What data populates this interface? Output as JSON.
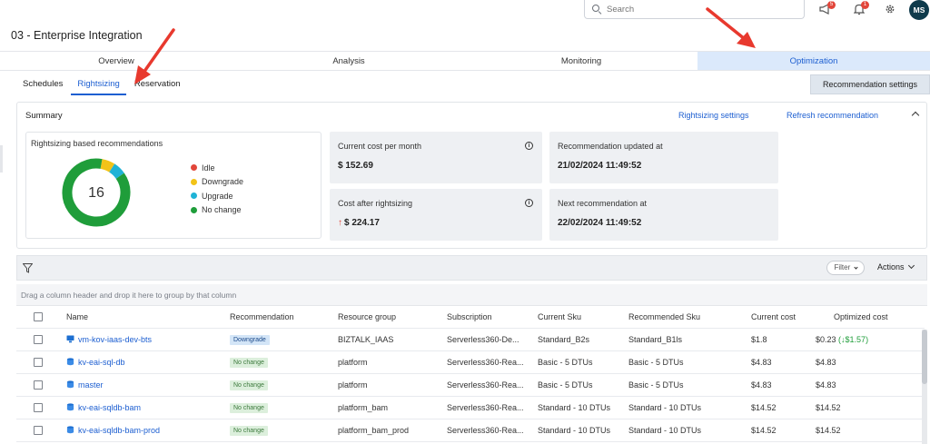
{
  "search": {
    "placeholder": "Search"
  },
  "header": {
    "megaphone_badge": "5",
    "bell_badge": "1",
    "avatar_initials": "MS"
  },
  "page_title": "03 - Enterprise Integration",
  "main_tabs": [
    {
      "label": "Overview",
      "active": false
    },
    {
      "label": "Analysis",
      "active": false
    },
    {
      "label": "Monitoring",
      "active": false
    },
    {
      "label": "Optimization",
      "active": true
    }
  ],
  "sub_tabs": [
    {
      "label": "Schedules",
      "active": false
    },
    {
      "label": "Rightsizing",
      "active": true
    },
    {
      "label": "Reservation",
      "active": false
    }
  ],
  "recommendation_settings_label": "Recommendation settings",
  "summary": {
    "title": "Summary",
    "rightsizing_settings_link": "Rightsizing settings",
    "refresh_link": "Refresh recommendation",
    "donut": {
      "title": "Rightsizing based recommendations",
      "total": "16",
      "segments": [
        {
          "label": "Idle",
          "value": 0,
          "color": "#e2463a"
        },
        {
          "label": "Downgrade",
          "value": 1,
          "color": "#f2c318"
        },
        {
          "label": "Upgrade",
          "value": 1,
          "color": "#1fb3d6"
        },
        {
          "label": "No change",
          "value": 14,
          "color": "#1f9d3a"
        }
      ]
    },
    "current_cost_label": "Current cost per month",
    "current_cost_value": "$ 152.69",
    "after_cost_label": "Cost after rightsizing",
    "after_cost_value": "$ 224.17",
    "updated_label": "Recommendation updated at",
    "updated_value": "21/02/2024 11:49:52",
    "next_label": "Next recommendation at",
    "next_value": "22/02/2024 11:49:52"
  },
  "toolbar": {
    "filter_label": "Filter",
    "actions_label": "Actions",
    "group_hint": "Drag a column header and drop it here to group by that column"
  },
  "table": {
    "columns": [
      "Name",
      "Recommendation",
      "Resource group",
      "Subscription",
      "Current Sku",
      "Recommended Sku",
      "Current cost",
      "Optimized cost"
    ],
    "rows": [
      {
        "icon": "virtual-machine-icon",
        "name": "vm-kov-iaas-dev-bts",
        "recommendation": "Downgrade",
        "resource_group": "BIZTALK_IAAS",
        "subscription": "Serverless360-De...",
        "current_sku": "Standard_B2s",
        "recommended_sku": "Standard_B1ls",
        "current_cost": "$1.8",
        "optimized_cost": "$0.23",
        "saving": "(↓$1.57)"
      },
      {
        "icon": "database-icon",
        "name": "kv-eai-sql-db",
        "recommendation": "No change",
        "resource_group": "platform",
        "subscription": "Serverless360-Rea...",
        "current_sku": "Basic - 5 DTUs",
        "recommended_sku": "Basic - 5 DTUs",
        "current_cost": "$4.83",
        "optimized_cost": "$4.83",
        "saving": ""
      },
      {
        "icon": "database-icon",
        "name": "master",
        "recommendation": "No change",
        "resource_group": "platform",
        "subscription": "Serverless360-Rea...",
        "current_sku": "Basic - 5 DTUs",
        "recommended_sku": "Basic - 5 DTUs",
        "current_cost": "$4.83",
        "optimized_cost": "$4.83",
        "saving": ""
      },
      {
        "icon": "database-icon",
        "name": "kv-eai-sqldb-bam",
        "recommendation": "No change",
        "resource_group": "platform_bam",
        "subscription": "Serverless360-Rea...",
        "current_sku": "Standard - 10 DTUs",
        "recommended_sku": "Standard - 10 DTUs",
        "current_cost": "$14.52",
        "optimized_cost": "$14.52",
        "saving": ""
      },
      {
        "icon": "database-icon",
        "name": "kv-eai-sqldb-bam-prod",
        "recommendation": "No change",
        "resource_group": "platform_bam_prod",
        "subscription": "Serverless360-Rea...",
        "current_sku": "Standard - 10 DTUs",
        "recommended_sku": "Standard - 10 DTUs",
        "current_cost": "$14.52",
        "optimized_cost": "$14.52",
        "saving": ""
      }
    ]
  },
  "colors": {
    "accent": "#1d5fd1",
    "active_tab_bg": "#dbe9fb",
    "annotation_arrow": "#e8392e"
  }
}
